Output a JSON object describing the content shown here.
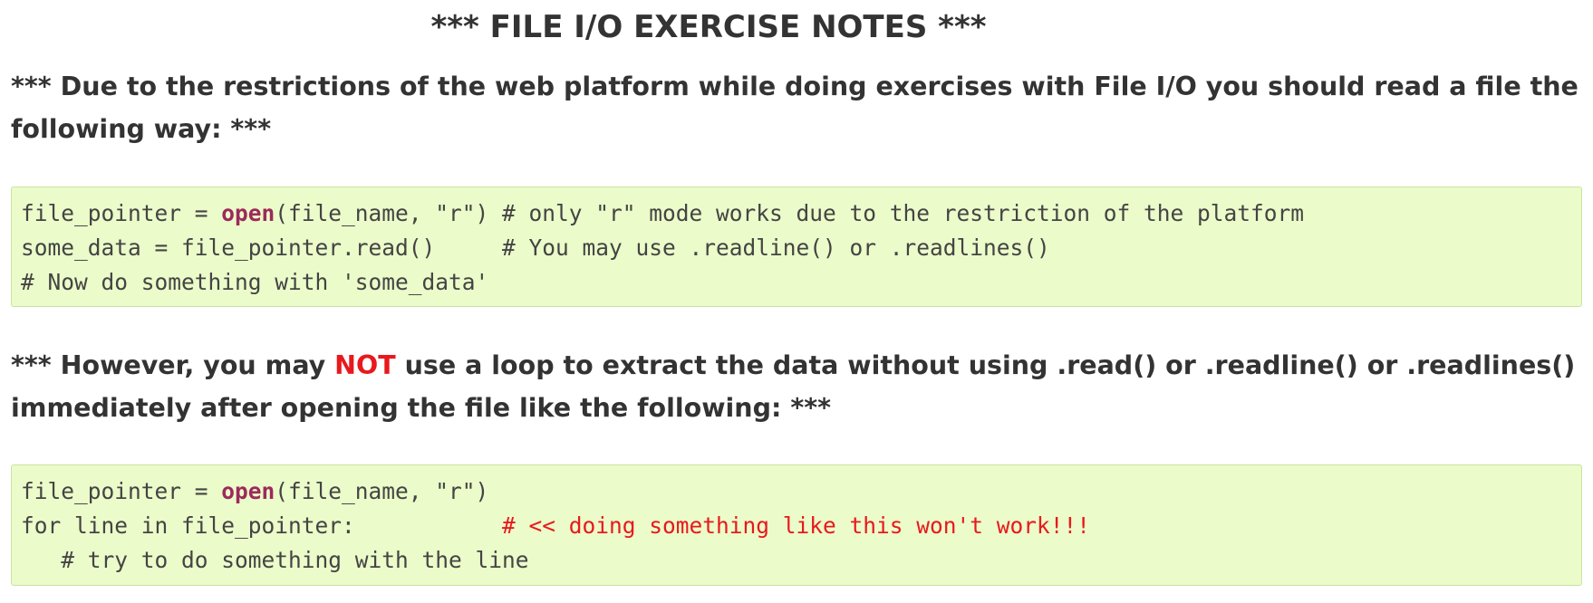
{
  "title": "*** FILE I/O EXERCISE NOTES ***",
  "para1": "*** Due to the restrictions of the web platform while doing exercises with File I/O you should read a file the following way: ***",
  "para2": {
    "before": "*** However, you may ",
    "highlight": "NOT",
    "after": " use a loop to extract the data without using .read() or .readline() or .readlines() immediately after opening the file like the following: ***"
  },
  "code1": {
    "line1": {
      "pre": "file_pointer = ",
      "keyword": "open",
      "post": "(file_name, \"r\") # only \"r\" mode works due to the restriction of the platform"
    },
    "line2": "some_data = file_pointer.read()     # You may use .readline() or .readlines()",
    "line3": "# Now do something with 'some_data'"
  },
  "code2": {
    "line1": {
      "pre": "file_pointer = ",
      "keyword": "open",
      "post": "(file_name, \"r\")"
    },
    "line2": {
      "code": "for line in file_pointer:           ",
      "comment": "# << doing something like this won't work!!!"
    },
    "line3": "   # try to do something with the line"
  },
  "colors": {
    "text": "#333333",
    "code_background": "#ebfbc9",
    "code_border": "#c9e3a3",
    "keyword": "#9c2a5c",
    "warning_red": "#e8191e"
  }
}
